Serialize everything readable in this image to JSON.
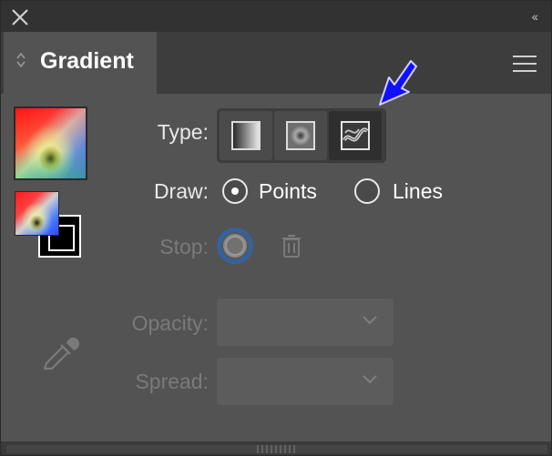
{
  "window": {
    "collapse_glyph": "‹‹"
  },
  "tab": {
    "label": "Gradient",
    "arrows_glyph": "◇"
  },
  "type_row": {
    "label": "Type:",
    "options": [
      {
        "name": "linear-gradient-icon",
        "selected": false
      },
      {
        "name": "radial-gradient-icon",
        "selected": false
      },
      {
        "name": "freeform-gradient-icon",
        "selected": true
      }
    ]
  },
  "draw_row": {
    "label": "Draw:",
    "points_label": "Points",
    "lines_label": "Lines",
    "selected": "Points"
  },
  "stop_row": {
    "label": "Stop:"
  },
  "opacity_row": {
    "label": "Opacity:",
    "value": ""
  },
  "spread_row": {
    "label": "Spread:",
    "value": ""
  },
  "colors": {
    "panel_bg": "#535353",
    "titlebar_bg": "#323232",
    "accent_arrow": "#1010ff",
    "text": "#e8e8e8",
    "text_dim": "#7a7a7a"
  }
}
